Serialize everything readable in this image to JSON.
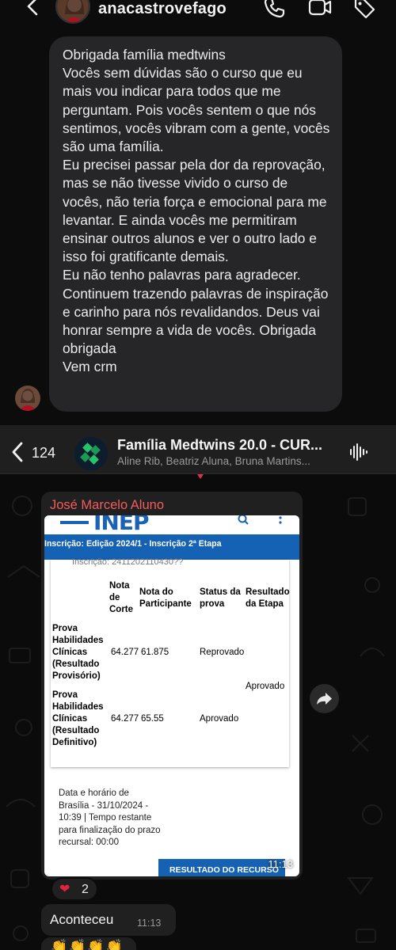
{
  "instagram": {
    "username": "anacastrovefago",
    "icons": [
      "back-arrow-icon",
      "avatar",
      "phone-icon",
      "video-icon",
      "tag-icon"
    ],
    "message_lines": [
      "Obrigada família medtwins",
      "Vocês sem dúvidas são o curso que eu mais vou indicar para todos que me perguntam. Pois vocês sentem o que nós sentimos, vocês vibram com a gente, vocês são uma família.",
      "Eu precisei passar pela dor da reprovação, mas se não tivesse vivido o curso de vocês, não teria força e emocional para me levantar. E ainda vocês me permitiram ensinar outros alunos e ver o outro lado e isso foi gratificante demais.",
      "Eu não tenho palavras para agradecer.",
      "Continuem trazendo palavras de inspiração e carinho para nós revalidandos. Deus vai honrar sempre a vida de vocês. Obrigada obrigada",
      "Vem crm"
    ]
  },
  "whatsapp": {
    "unread_count": "124",
    "group_title": "Família Medtwins 20.0 - CUR...",
    "group_members": "Aline Rib, Beatriz Aluna, Bruna Martins...",
    "accent_color": "#f55b5b",
    "image_message": {
      "sender": "José Marcelo Aluno",
      "time": "11:13",
      "screenshot": {
        "logo": "INEP",
        "bar_text": "Inscrição:  Edição 2024/1 - Inscrição 2ª Etapa",
        "faded_line": "Inscrição: 2411202110430??",
        "col_headers": [
          "Nota de Corte",
          "Nota do Participante",
          "Status da prova",
          "Resultado da Etapa"
        ],
        "rows": [
          {
            "label": "Prova Habilidades Clínicas (Resultado Provisório)",
            "nota_corte": "64.277",
            "nota_participante": "61.875",
            "status": "Reprovado"
          },
          {
            "label": "Prova Habilidades Clínicas (Resultado Definitivo)",
            "nota_corte": "64.277",
            "nota_participante": "65.55",
            "status": "Aprovado"
          }
        ],
        "resultado_etapa": "Aprovado",
        "footer": "Data e horário de Brasília - 31/10/2024 - 10:39 | Tempo restante para finalização do prazo recursal: 00:00",
        "button": "RESULTADO DO RECURSO"
      }
    },
    "reaction": {
      "emoji": "❤",
      "count": "2"
    },
    "text_message": {
      "text": "Aconteceu",
      "time": "11:13"
    },
    "emoji_message": {
      "text": "👏👏👏👏"
    }
  }
}
